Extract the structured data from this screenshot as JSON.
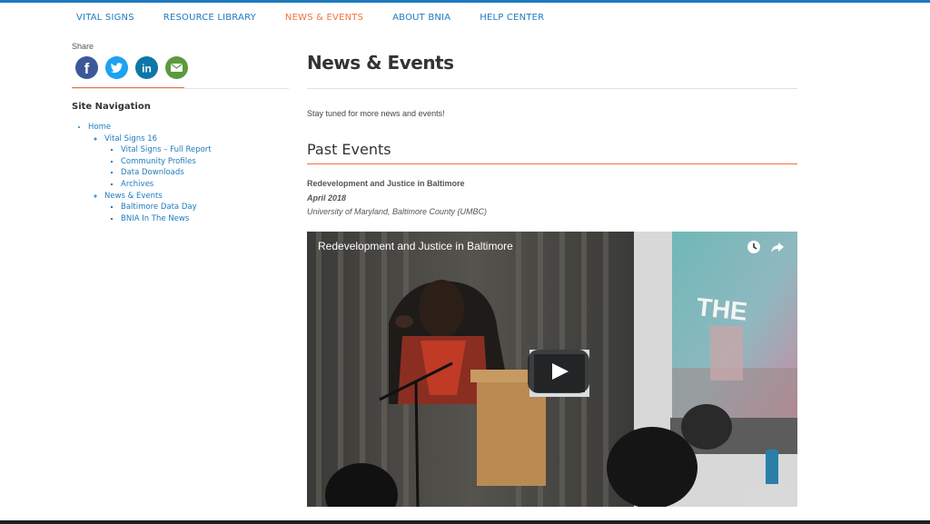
{
  "nav": {
    "items": [
      {
        "label": "VITAL SIGNS",
        "active": false
      },
      {
        "label": "RESOURCE LIBRARY",
        "active": false
      },
      {
        "label": "NEWS & EVENTS",
        "active": true
      },
      {
        "label": "ABOUT BNIA",
        "active": false
      },
      {
        "label": "HELP CENTER",
        "active": false
      }
    ]
  },
  "sidebar": {
    "share_label": "Share",
    "social_icons": [
      "facebook-icon",
      "twitter-icon",
      "linkedin-icon",
      "email-icon"
    ],
    "site_nav_title": "Site Navigation",
    "tree": {
      "home": "Home",
      "vital_signs": "Vital Signs 16",
      "vs_children": [
        "Vital Signs – Full Report",
        "Community Profiles",
        "Data Downloads",
        "Archives"
      ],
      "news": "News & Events",
      "news_children": [
        "Baltimore Data Day",
        "BNIA In The News"
      ]
    }
  },
  "main": {
    "title": "News & Events",
    "lead": "Stay tuned for more news and events!",
    "past_heading": "Past Events",
    "event": {
      "title": "Redevelopment and Justice in Baltimore",
      "date": "April 2018",
      "place": "University of Maryland, Baltimore County (UMBC)"
    },
    "video": {
      "title": "Redevelopment and Justice in Baltimore",
      "icons": [
        "clock-icon",
        "share-icon",
        "play-icon"
      ]
    }
  },
  "colors": {
    "primary": "#1f7bbf",
    "accent": "#f2713b",
    "facebook": "#3b5998",
    "twitter": "#1da1f2",
    "linkedin": "#0e76a8",
    "email": "#5c9a3c"
  }
}
